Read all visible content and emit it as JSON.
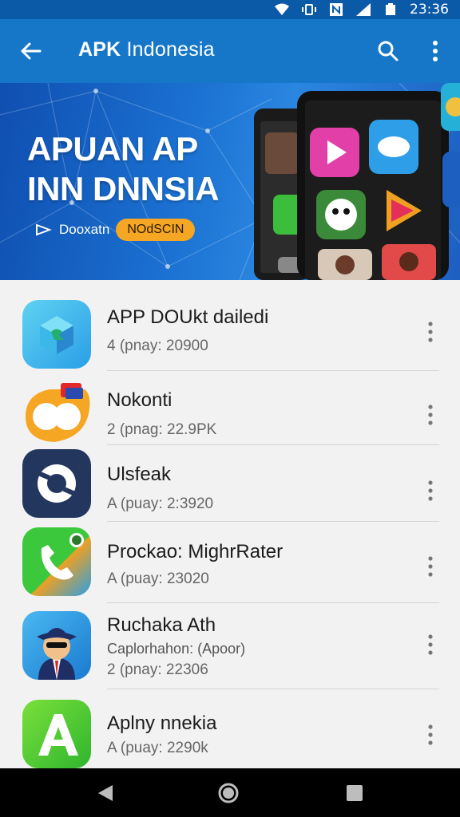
{
  "status_bar": {
    "time": "23:36"
  },
  "app_bar": {
    "title_bold": "APK",
    "title_rest": " Indonesia"
  },
  "banner": {
    "headline_line1": "APUAN AP",
    "headline_line2": "INN DNNSIA",
    "sub_text": "Dooxatn",
    "pill_text": "NOdSCIN"
  },
  "apps": [
    {
      "name": "APP DOUkt dailedi",
      "developer": "",
      "meta": "4 (pnay:  20900"
    },
    {
      "name": "Nokonti",
      "developer": "",
      "meta": "2 (pnag:  22.9PK"
    },
    {
      "name": "Ulsfeak",
      "developer": "",
      "meta": "A (puay:  2:3920"
    },
    {
      "name": "Prockao: MighrRater",
      "developer": "",
      "meta": "A (puay:  23020"
    },
    {
      "name": "Ruchaka Ath",
      "developer": "Caplorhahon: (Apoor)",
      "meta": "2 (pnay:  22306"
    },
    {
      "name": "Aplny nnekia",
      "developer": "",
      "meta": "A (puay:  2290k"
    }
  ],
  "colors": {
    "status_bar": "#0a5aa8",
    "app_bar": "#1677c9",
    "list_bg": "#f2f2f2",
    "accent_pill": "#f5a623"
  },
  "icons": [
    "back-arrow-icon",
    "search-icon",
    "more-vert-icon",
    "wifi-icon",
    "signal-icon",
    "battery-icon",
    "nav-back-icon",
    "nav-home-icon",
    "nav-recents-icon"
  ]
}
